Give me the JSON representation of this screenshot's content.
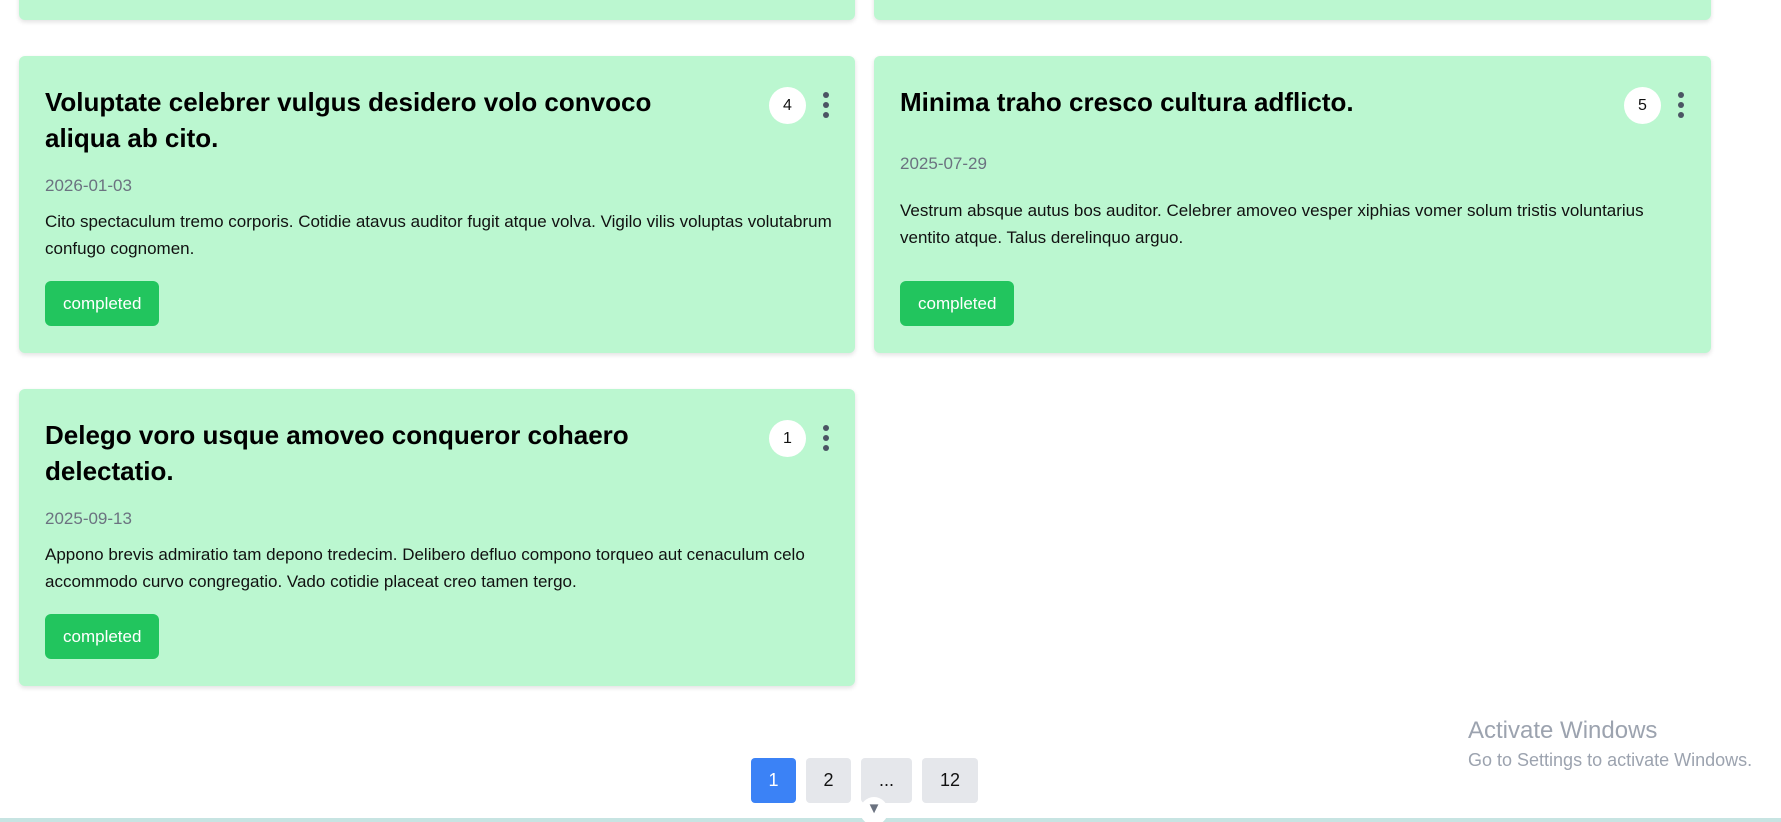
{
  "cards": [
    {
      "title": "Voluptate celebrer vulgus desidero volo convoco aliqua ab cito.",
      "date": "2026-01-03",
      "description": "Cito spectaculum tremo corporis. Cotidie atavus auditor fugit atque volva. Vigilo vilis voluptas volutabrum confugo cognomen.",
      "status": "completed",
      "count": "4"
    },
    {
      "title": "Minima traho cresco cultura adflicto.",
      "date": "2025-07-29",
      "description": "Vestrum absque autus bos auditor. Celebrer amoveo vesper xiphias vomer solum tristis voluntarius ventito atque. Talus derelinquo arguo.",
      "status": "completed",
      "count": "5"
    },
    {
      "title": "Delego voro usque amoveo conqueror cohaero delectatio.",
      "date": "2025-09-13",
      "description": "Appono brevis admiratio tam depono tredecim. Delibero defluo compono torqueo aut cenaculum celo accommodo curvo congregatio. Vado cotidie placeat creo tamen tergo.",
      "status": "completed",
      "count": "1"
    }
  ],
  "pagination": {
    "pages": [
      "1",
      "2",
      "...",
      "12"
    ],
    "current": "1"
  },
  "watermark": {
    "title": "Activate Windows",
    "subtitle": "Go to Settings to activate Windows."
  },
  "icons": {
    "more": "more-vertical-icon",
    "scroll": "chevron-down-icon"
  },
  "colors": {
    "card_background": "#bbf7d0",
    "completed_badge": "#22c55e",
    "active_page": "#3b82f6",
    "inactive_page": "#e5e7eb"
  }
}
